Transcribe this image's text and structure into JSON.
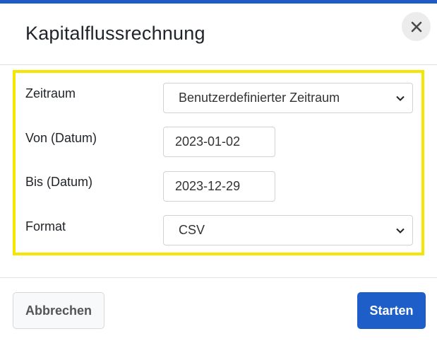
{
  "dialog": {
    "title": "Kapitalflussrechnung",
    "close_icon": "close-icon"
  },
  "form": {
    "period": {
      "label": "Zeitraum",
      "value": "Benutzerdefinierter Zeitraum"
    },
    "from_date": {
      "label": "Von (Datum)",
      "value": "2023-01-02"
    },
    "to_date": {
      "label": "Bis (Datum)",
      "value": "2023-12-29"
    },
    "format": {
      "label": "Format",
      "value": "CSV"
    }
  },
  "footer": {
    "cancel_label": "Abbrechen",
    "start_label": "Starten"
  },
  "colors": {
    "accent": "#1e5ec8",
    "highlight_frame": "#f5e600",
    "top_bar": "#1f5bc4"
  }
}
